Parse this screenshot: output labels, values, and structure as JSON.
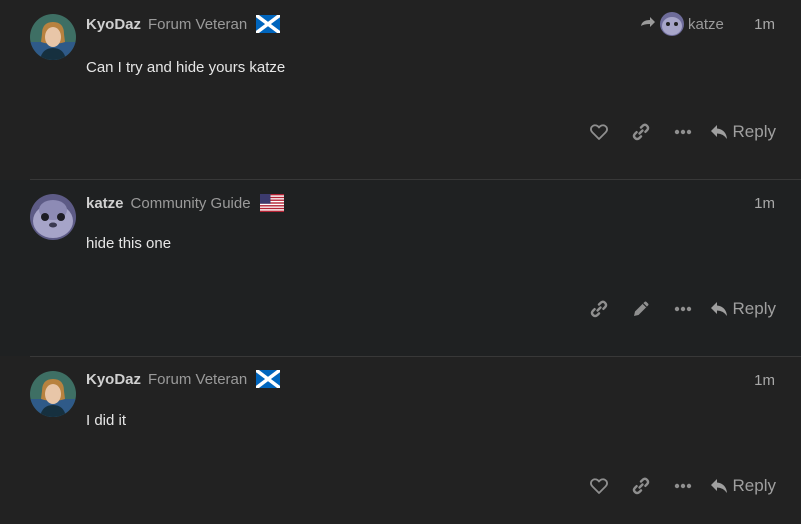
{
  "posts": [
    {
      "username": "KyoDaz",
      "user_title": "Forum Veteran",
      "flag": "scotland-flag",
      "reply_to": "katze",
      "time": "1m",
      "text": "Can I try and hide yours katze",
      "actions": [
        "heart-icon",
        "link-icon",
        "more-icon"
      ],
      "reply_label": "Reply"
    },
    {
      "username": "katze",
      "user_title": "Community Guide",
      "flag": "usa-flag",
      "time": "1m",
      "text": "hide this one",
      "actions": [
        "link-icon",
        "pencil-icon",
        "more-icon"
      ],
      "reply_label": "Reply"
    },
    {
      "username": "KyoDaz",
      "user_title": "Forum Veteran",
      "flag": "scotland-flag",
      "time": "1m",
      "text": "I did it",
      "actions": [
        "heart-icon",
        "link-icon",
        "more-icon"
      ],
      "reply_label": "Reply"
    }
  ],
  "colors": {
    "background": "#222222",
    "highlight_background": "#1f2122",
    "icon": "#8f8f8f"
  }
}
